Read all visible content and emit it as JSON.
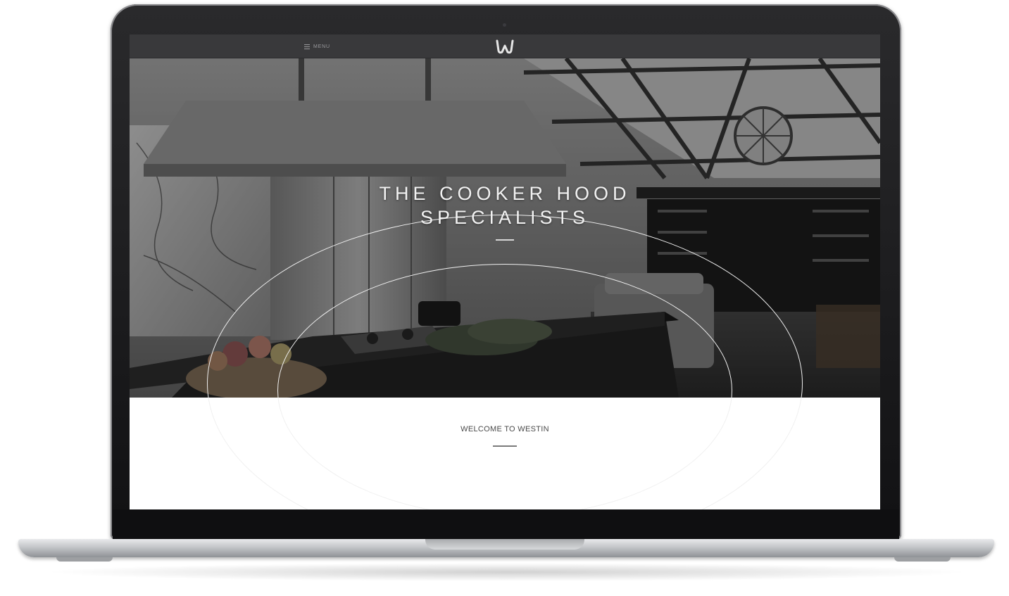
{
  "nav": {
    "menu_label": "MENU",
    "logo_letter": "W",
    "icons": {
      "menu": "hamburger-icon",
      "logo": "westin-logo-icon"
    }
  },
  "hero": {
    "title_line1": "THE COOKER HOOD",
    "title_line2": "SPECIALISTS",
    "subtitle": "",
    "background": "monochrome kitchen photograph"
  },
  "welcome": {
    "heading": "WELCOME TO WESTIN",
    "body": ""
  },
  "colors": {
    "nav_background": "#39393b",
    "hero_overlay": "#000000",
    "welcome_background": "#ffffff",
    "laptop_bezel": "#111113",
    "laptop_base": "#c3c5c8"
  }
}
